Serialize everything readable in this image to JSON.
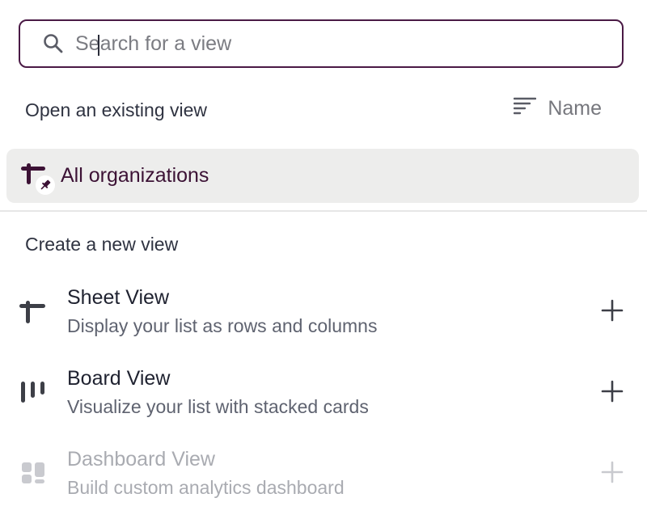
{
  "search": {
    "placeholder": "Search for a view"
  },
  "existing_section": {
    "title": "Open an existing view",
    "sort_label": "Name",
    "items": [
      {
        "label": "All organizations",
        "pinned": true
      }
    ]
  },
  "create_section": {
    "title": "Create a new view",
    "items": [
      {
        "title": "Sheet View",
        "description": "Display your list as rows and columns",
        "icon": "sheet-view-icon",
        "enabled": true
      },
      {
        "title": "Board View",
        "description": "Visualize your list with stacked cards",
        "icon": "board-view-icon",
        "enabled": true
      },
      {
        "title": "Dashboard View",
        "description": "Build custom analytics dashboard",
        "icon": "dashboard-view-icon",
        "enabled": false
      }
    ]
  },
  "colors": {
    "accent": "#4a1a45",
    "highlight_bg": "#ededec",
    "text_primary": "#1f2230",
    "text_secondary": "#5f6370",
    "text_disabled": "#a9abb1"
  }
}
